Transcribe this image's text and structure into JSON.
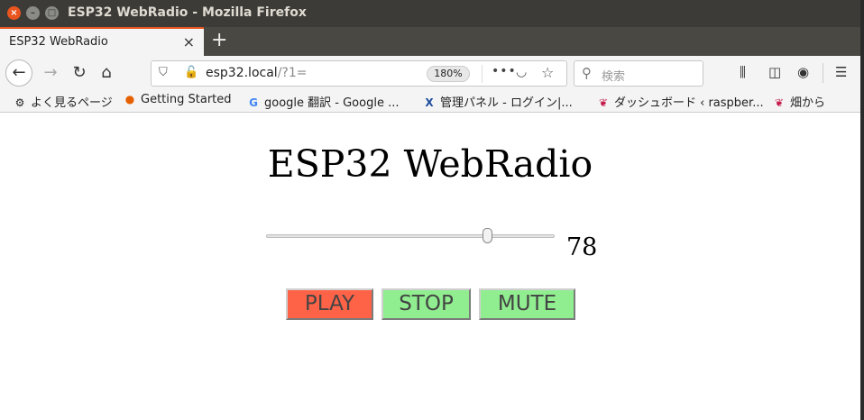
{
  "window": {
    "title": "ESP32 WebRadio - Mozilla Firefox"
  },
  "tab": {
    "label": "ESP32 WebRadio"
  },
  "navbar": {
    "url_host": "esp32.local",
    "url_path": "/?1=",
    "zoom": "180%",
    "search_placeholder": "検索"
  },
  "bookmarks": [
    {
      "label": "よく見るページ",
      "icon": "gear-icon"
    },
    {
      "label": "Getting Started",
      "icon": "firefox-icon"
    },
    {
      "label": "google 翻訳 - Google ...",
      "icon": "google-icon"
    },
    {
      "label": "管理パネル - ログイン|...",
      "icon": "x-icon"
    },
    {
      "label": "ダッシュボード ‹ raspber...",
      "icon": "raspberry-icon"
    },
    {
      "label": "畑から",
      "icon": "raspberry-icon"
    }
  ],
  "page": {
    "title": "ESP32 WebRadio",
    "volume": {
      "value": "78",
      "fraction": 0.78
    },
    "buttons": {
      "play": "PLAY",
      "stop": "STOP",
      "mute": "MUTE"
    }
  },
  "colors": {
    "play": "#ff6347",
    "stop": "#90ee90",
    "mute": "#90ee90",
    "accent": "#e95420"
  }
}
